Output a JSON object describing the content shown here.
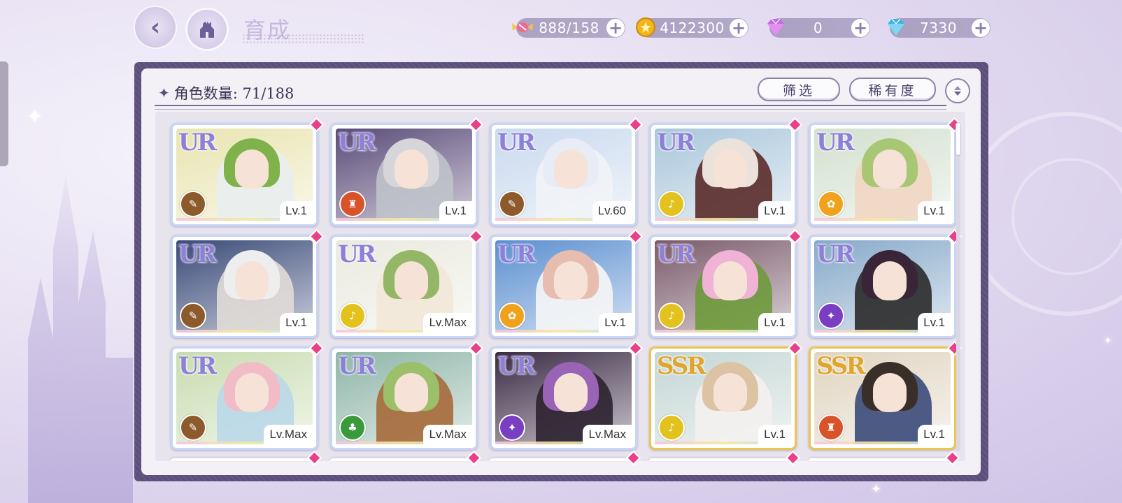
{
  "header": {
    "title": "育成",
    "back_icon": "back-arrow-icon",
    "home_icon": "castle-home-icon"
  },
  "currencies": [
    {
      "name": "candy",
      "icon": "candy-icon",
      "value": "888/158",
      "color": "#e74d7d"
    },
    {
      "name": "gold",
      "icon": "gold-coin-icon",
      "value": "4122300",
      "color": "#f2b51c"
    },
    {
      "name": "gem-pink",
      "icon": "pink-gem-icon",
      "value": "0",
      "color": "#c46ae0"
    },
    {
      "name": "diamond",
      "icon": "blue-diamond-icon",
      "value": "7330",
      "color": "#4fc3ea"
    }
  ],
  "panel": {
    "count_label": "角色数量: 71/188",
    "filter_label": "筛选",
    "rarity_label": "稀有度",
    "sort_icon": "sort-toggle-icon"
  },
  "cards": [
    {
      "rarity": "UR",
      "level": "Lv.1",
      "attr_color": "#8d5a2c",
      "hair": "#7fb24a",
      "bg": "#e9e4b0",
      "outfit": "#e9eef0"
    },
    {
      "rarity": "UR",
      "level": "Lv.1",
      "attr_color": "#d8532a",
      "hair": "#d6d6da",
      "bg": "#5a4a78",
      "outfit": "#bfc3ca"
    },
    {
      "rarity": "UR",
      "level": "Lv.60",
      "attr_color": "#8d5a2c",
      "hair": "#e8ecf6",
      "bg": "#c9d9ee",
      "outfit": "#f1f3f7"
    },
    {
      "rarity": "UR",
      "level": "Lv.1",
      "attr_color": "#e4c21e",
      "hair": "#ece2dc",
      "bg": "#a9c6db",
      "outfit": "#5a2b2a"
    },
    {
      "rarity": "UR",
      "level": "Lv.1",
      "attr_color": "#f0a21c",
      "hair": "#a8c774",
      "bg": "#d3e0cf",
      "outfit": "#f2d6c3"
    },
    {
      "rarity": "UR",
      "level": "Lv.1",
      "attr_color": "#8d5a2c",
      "hair": "#eeeeee",
      "bg": "#3a4a78",
      "outfit": "#e0dcd7"
    },
    {
      "rarity": "UR",
      "level": "Lv.Max",
      "attr_color": "#e4c21e",
      "hair": "#93b766",
      "bg": "#eaeadf",
      "outfit": "#f3e8d8"
    },
    {
      "rarity": "UR",
      "level": "Lv.1",
      "attr_color": "#f0a21c",
      "hair": "#e7bdb0",
      "bg": "#5b8fd0",
      "outfit": "#f6f6f6"
    },
    {
      "rarity": "UR",
      "level": "Lv.1",
      "attr_color": "#e4c21e",
      "hair": "#f0b3d6",
      "bg": "#7a5a6a",
      "outfit": "#6e9a3c"
    },
    {
      "rarity": "UR",
      "level": "Lv.1",
      "attr_color": "#7a3ec2",
      "hair": "#3a2438",
      "bg": "#86a9c9",
      "outfit": "#2a2a2a"
    },
    {
      "rarity": "UR",
      "level": "Lv.Max",
      "attr_color": "#8d5a2c",
      "hair": "#f2bcc6",
      "bg": "#c8dcb0",
      "outfit": "#b9d8e8"
    },
    {
      "rarity": "UR",
      "level": "Lv.Max",
      "attr_color": "#3a9a3a",
      "hair": "#9cbf6a",
      "bg": "#8fb6a8",
      "outfit": "#a66a3a"
    },
    {
      "rarity": "UR",
      "level": "Lv.Max",
      "attr_color": "#7a3ec2",
      "hair": "#9a64b6",
      "bg": "#3a2a44",
      "outfit": "#2c2230"
    },
    {
      "rarity": "SSR",
      "level": "Lv.1",
      "attr_color": "#e4c21e",
      "hair": "#dbc3a4",
      "bg": "#c4d6d4",
      "outfit": "#f3f1f0"
    },
    {
      "rarity": "SSR",
      "level": "Lv.1",
      "attr_color": "#d8532a",
      "hair": "#3a2e28",
      "bg": "#e0d4c0",
      "outfit": "#3a4a7a"
    }
  ],
  "partial_row_count": 5
}
